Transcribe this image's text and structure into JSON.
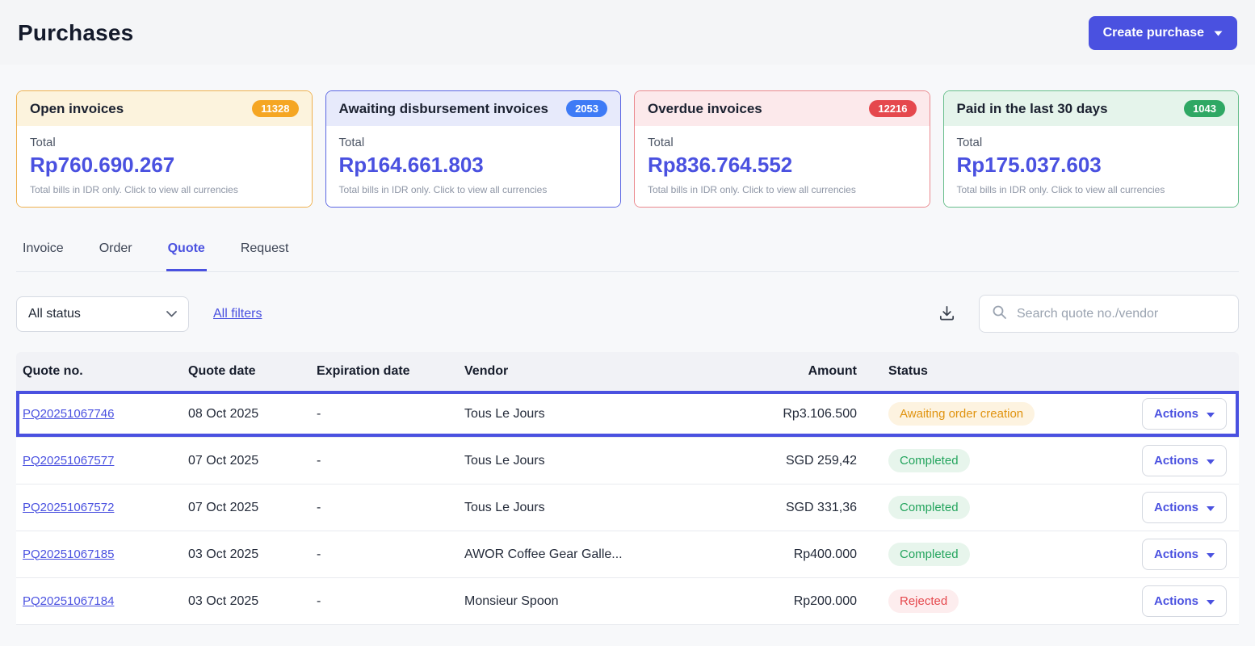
{
  "page": {
    "title": "Purchases"
  },
  "header": {
    "create_button": "Create purchase"
  },
  "colors": {
    "accent": "#4A51E0",
    "open-border": "#EFB14E",
    "open-header-bg": "#FCF3DD",
    "open-badge": "#F5A623",
    "awaiting-border": "#5B66E3",
    "awaiting-header-bg": "#E7EAFB",
    "awaiting-badge": "#3E7BF6",
    "overdue-border": "#EA888D",
    "overdue-header-bg": "#FCE9EB",
    "overdue-badge": "#E5484D",
    "paid-border": "#67BE8B",
    "paid-header-bg": "#E5F4EB",
    "paid-badge": "#2FA864",
    "status-awaiting-text": "#E0930F",
    "status-awaiting-bg": "#FDF3E0",
    "status-completed-text": "#23A45D",
    "status-completed-bg": "#E7F5EC",
    "status-rejected-text": "#E5484D",
    "status-rejected-bg": "#FDEDEE"
  },
  "cards": [
    {
      "title": "Open invoices",
      "count": "11328",
      "total_label": "Total",
      "amount": "Rp760.690.267",
      "note": "Total bills in IDR only. Click to view all currencies"
    },
    {
      "title": "Awaiting disbursement invoices",
      "count": "2053",
      "total_label": "Total",
      "amount": "Rp164.661.803",
      "note": "Total bills in IDR only. Click to view all currencies"
    },
    {
      "title": "Overdue invoices",
      "count": "12216",
      "total_label": "Total",
      "amount": "Rp836.764.552",
      "note": "Total bills in IDR only. Click to view all currencies"
    },
    {
      "title": "Paid in the last 30 days",
      "count": "1043",
      "total_label": "Total",
      "amount": "Rp175.037.603",
      "note": "Total bills in IDR only. Click to view all currencies"
    }
  ],
  "tabs": [
    {
      "label": "Invoice"
    },
    {
      "label": "Order"
    },
    {
      "label": "Quote"
    },
    {
      "label": "Request"
    }
  ],
  "filters": {
    "status_value": "All status",
    "all_filters": "All filters",
    "search_placeholder": "Search quote no./vendor"
  },
  "table": {
    "headers": {
      "quote_no": "Quote no.",
      "quote_date": "Quote date",
      "expiration_date": "Expiration date",
      "vendor": "Vendor",
      "amount": "Amount",
      "status": "Status"
    },
    "actions_label": "Actions",
    "rows": [
      {
        "quote_no": "PQ20251067746",
        "quote_date": "08 Oct 2025",
        "expiration_date": "-",
        "vendor": "Tous Le Jours",
        "amount": "Rp3.106.500",
        "status": "Awaiting order creation"
      },
      {
        "quote_no": "PQ20251067577",
        "quote_date": "07 Oct 2025",
        "expiration_date": "-",
        "vendor": "Tous Le Jours",
        "amount": "SGD 259,42",
        "status": "Completed"
      },
      {
        "quote_no": "PQ20251067572",
        "quote_date": "07 Oct 2025",
        "expiration_date": "-",
        "vendor": "Tous Le Jours",
        "amount": "SGD 331,36",
        "status": "Completed"
      },
      {
        "quote_no": "PQ20251067185",
        "quote_date": "03 Oct 2025",
        "expiration_date": "-",
        "vendor": "AWOR Coffee Gear Galle...",
        "amount": "Rp400.000",
        "status": "Completed"
      },
      {
        "quote_no": "PQ20251067184",
        "quote_date": "03 Oct 2025",
        "expiration_date": "-",
        "vendor": "Monsieur Spoon",
        "amount": "Rp200.000",
        "status": "Rejected"
      }
    ]
  }
}
